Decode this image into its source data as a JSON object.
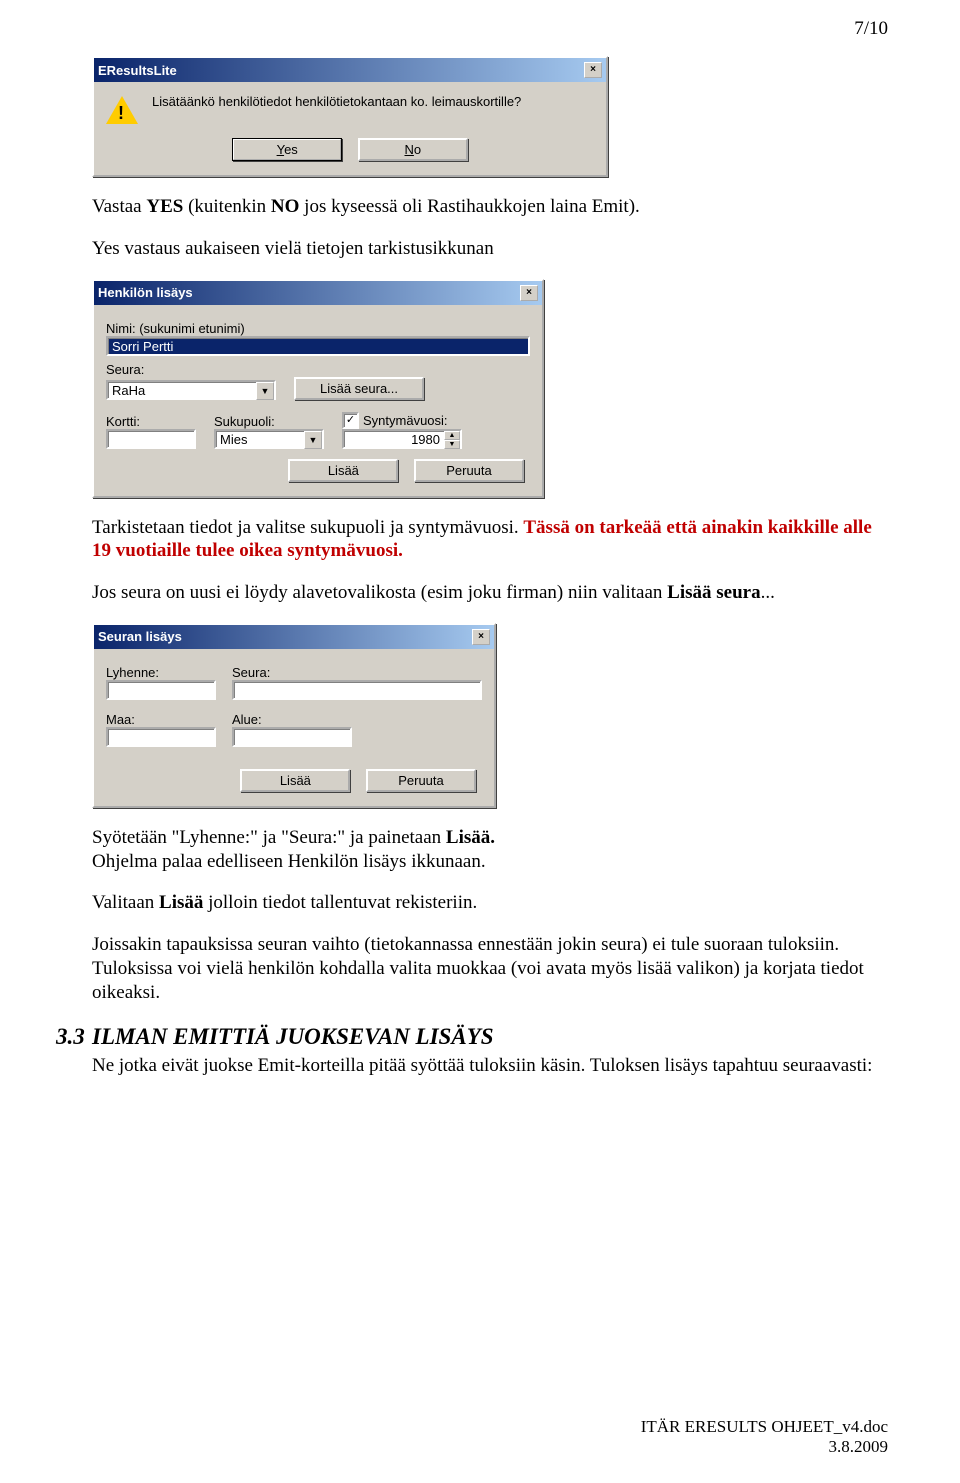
{
  "page_number": "7/10",
  "msgbox": {
    "title": "EResultsLite",
    "message": "Lisätäänkö henkilötiedot henkilötietokantaan ko. leimauskortille?",
    "yes_key": "Y",
    "yes_rest": "es",
    "no_key": "N",
    "no_rest": "o"
  },
  "para1_pre": "Vastaa ",
  "para1_yes": "YES",
  "para1_mid": " (kuitenkin ",
  "para1_no": "NO",
  "para1_post": " jos kyseessä oli Rastihaukkojen laina Emit).",
  "para2": "Yes vastaus aukaiseen vielä tietojen tarkistusikkunan",
  "henkilo": {
    "title": "Henkilön lisäys",
    "nimi_label": "Nimi: (sukunimi etunimi)",
    "nimi_value": "Sorri Pertti",
    "seura_label": "Seura:",
    "seura_value": "RaHa",
    "lisaa_seura": "Lisää seura...",
    "kortti_label": "Kortti:",
    "kortti_value": "",
    "sukupuoli_label": "Sukupuoli:",
    "sukupuoli_value": "Mies",
    "syntymavuosi_label": "Syntymävuosi:",
    "syntymavuosi_value": "1980",
    "lisaa": "Lisää",
    "peruuta": "Peruuta"
  },
  "para3": "Tarkistetaan tiedot ja valitse sukupuoli ja syntymävuosi. ",
  "para3_red": "Tässä on tarkeää että ainakin kaikkille alle 19 vuotiaille tulee oikea syntymävuosi.",
  "para4_a": "Jos seura on uusi ei löydy alavetovalikosta (esim joku firman) niin valitaan ",
  "para4_b": "Lisää seura",
  "para4_c": "...",
  "seuran": {
    "title": "Seuran lisäys",
    "lyhenne_label": "Lyhenne:",
    "seura_label": "Seura:",
    "maa_label": "Maa:",
    "alue_label": "Alue:",
    "lisaa": "Lisää",
    "peruuta": "Peruuta"
  },
  "para5_a": "Syötetään \"Lyhenne:\" ja \"Seura:\" ja painetaan ",
  "para5_b": "Lisää.",
  "para6": "Ohjelma palaa edelliseen Henkilön lisäys ikkunaan.",
  "para7_a": "Valitaan ",
  "para7_b": "Lisää",
  "para7_c": " jolloin tiedot tallentuvat rekisteriin.",
  "para8": "Joissakin tapauksissa seuran vaihto (tietokannassa ennestään jokin seura) ei tule suoraan tuloksiin. Tuloksissa voi vielä henkilön kohdalla valita muokkaa (voi avata myös lisää valikon) ja korjata tiedot oikeaksi.",
  "sec_num": "3.3",
  "sec_title": "ILMAN EMITTIÄ JUOKSEVAN LISÄYS",
  "sec_body": "Ne jotka eivät juokse Emit-korteilla pitää syöttää tuloksiin käsin. Tuloksen lisäys tapahtuu seuraavasti:",
  "footer_doc": "ITÄR ERESULTS OHJEET_v4.doc",
  "footer_date": "3.8.2009"
}
